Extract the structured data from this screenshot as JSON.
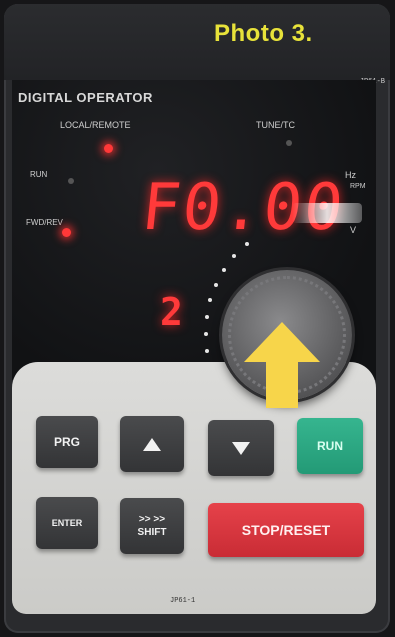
{
  "photo_label": "Photo 3.",
  "panel": {
    "brand_text": "DIGITAL OPERATOR",
    "local_remote_label": "LOCAL/REMOTE",
    "tune_label": "TUNE/TC",
    "run_label": "RUN",
    "fwd_label": "FWD/REV",
    "unit_hz": "Hz",
    "unit_rpm": "RPM",
    "unit_v": "V",
    "corner_code": "JP61-B",
    "model_code": "JP61-1"
  },
  "display": {
    "main_value": "F0.00",
    "sub_value": "2"
  },
  "keys": {
    "prg": "PRG",
    "run": "RUN",
    "enter": "ENTER",
    "shift_top": ">> >>",
    "shift": "SHIFT",
    "stop_reset": "STOP/RESET"
  },
  "colors": {
    "display_red": "#ff3a3a",
    "run_green": "#2aa882",
    "stop_red": "#d6333c",
    "arrow_yellow": "#f7d54a",
    "label_yellow": "#e8e23a"
  },
  "icons": {
    "up_key": "triangle-up-icon",
    "down_key": "triangle-down-icon",
    "pointer": "arrow-up-icon"
  }
}
